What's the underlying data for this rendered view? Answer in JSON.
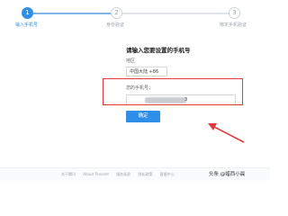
{
  "steps": [
    {
      "number": "1",
      "label": "输入手机号",
      "active": true
    },
    {
      "number": "2",
      "label": "身份验证",
      "active": false
    },
    {
      "number": "3",
      "label": "绑定手机验证",
      "active": false
    }
  ],
  "form": {
    "title": "请输入您要设置的手机号",
    "region_label": "地区",
    "region_value": "中国大陆 +86",
    "phone_label": "您的手机号：",
    "phone_suffix": "3",
    "confirm_label": "确定"
  },
  "footer": {
    "links": [
      "关于腾讯",
      "About Tencent",
      "服务条款",
      "隐私政策",
      "客服中心"
    ]
  },
  "watermark": {
    "text": "头条 @蜡西小晨"
  },
  "colors": {
    "accent": "#2f8fe8",
    "highlight": "#e23a3a"
  }
}
